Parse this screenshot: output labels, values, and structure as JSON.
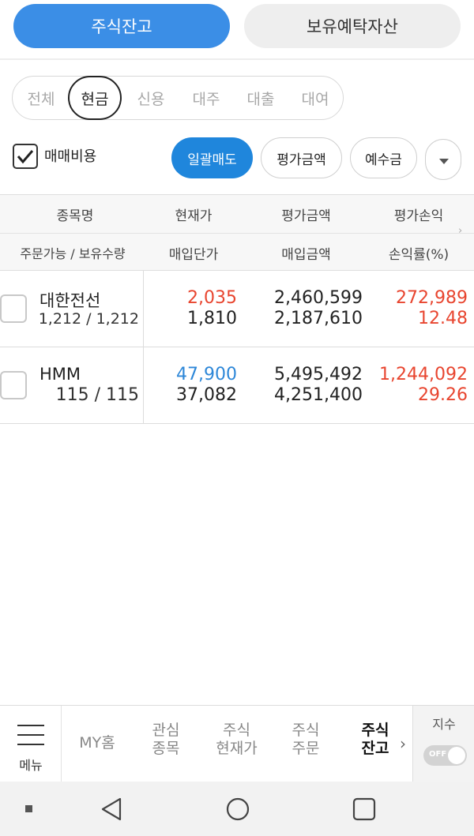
{
  "top_tabs": {
    "stock_balance": "주식잔고",
    "holding_assets": "보유예탁자산"
  },
  "filters": [
    "전체",
    "현금",
    "신용",
    "대주",
    "대출",
    "대여"
  ],
  "selected_filter": "현금",
  "options": {
    "fee_label": "매매비용",
    "fee_checked": true,
    "bulk_sell": "일괄매도",
    "eval_amount": "평가금액",
    "deposit": "예수금"
  },
  "table_header": {
    "row1": [
      "종목명",
      "현재가",
      "평가금액",
      "평가손익"
    ],
    "row2": [
      "주문가능 / 보유수량",
      "매입단가",
      "매입금액",
      "손익률(%)"
    ]
  },
  "rows": [
    {
      "name": "대한전선",
      "qty": "1,212 / 1,212",
      "current_price": "2,035",
      "purchase_price": "1,810",
      "eval_amount": "2,460,599",
      "purchase_amount": "2,187,610",
      "eval_pl": "272,989",
      "pl_rate": "12.48"
    },
    {
      "name": "HMM",
      "qty": "115 / 115",
      "current_price": "47,900",
      "purchase_price": "37,082",
      "eval_amount": "5,495,492",
      "purchase_amount": "4,251,400",
      "eval_pl": "1,244,092",
      "pl_rate": "29.26"
    }
  ],
  "bottom_nav": {
    "menu": "메뉴",
    "my_home": "MY홈",
    "watchlist_1": "관심",
    "watchlist_2": "종목",
    "price_1": "주식",
    "price_2": "현재가",
    "order_1": "주식",
    "order_2": "주문",
    "balance_1": "주식",
    "balance_2": "잔고",
    "index_label": "지수",
    "index_toggle": "OFF"
  },
  "colors": {
    "accent": "#3b8ee6",
    "primary_button": "#1f86dc",
    "up": "#e8452f",
    "down": "#2d87d8"
  }
}
